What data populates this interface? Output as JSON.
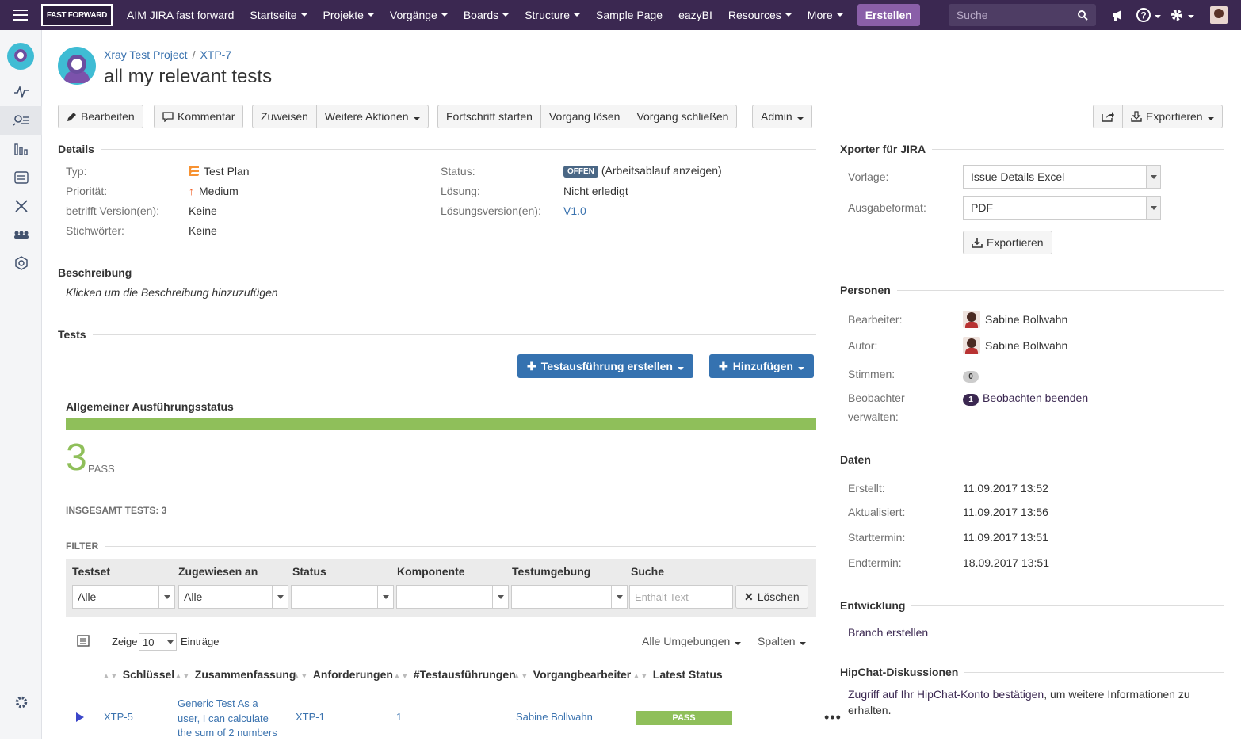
{
  "nav": {
    "logo_text": "FAST FORWARD",
    "title": "AIM JIRA fast forward",
    "items": [
      {
        "label": "Startseite",
        "caret": true
      },
      {
        "label": "Projekte",
        "caret": true
      },
      {
        "label": "Vorgänge",
        "caret": true
      },
      {
        "label": "Boards",
        "caret": true
      },
      {
        "label": "Structure",
        "caret": true
      },
      {
        "label": "Sample Page",
        "caret": false
      },
      {
        "label": "eazyBI",
        "caret": false
      },
      {
        "label": "Resources",
        "caret": true
      },
      {
        "label": "More",
        "caret": true
      }
    ],
    "create_label": "Erstellen",
    "search_placeholder": "Suche"
  },
  "breadcrumb": {
    "project": "Xray Test Project",
    "sep": "/",
    "key": "XTP-7"
  },
  "issue_title": "all my relevant tests",
  "toolbar": {
    "edit": "Bearbeiten",
    "comment": "Kommentar",
    "assign": "Zuweisen",
    "more_actions": "Weitere Aktionen",
    "start_progress": "Fortschritt starten",
    "resolve": "Vorgang lösen",
    "close": "Vorgang schließen",
    "admin": "Admin",
    "export": "Exportieren"
  },
  "details": {
    "heading": "Details",
    "type_label": "Typ:",
    "type_value": "Test Plan",
    "priority_label": "Priorität:",
    "priority_value": "Medium",
    "affects_label": "betrifft Version(en):",
    "affects_value": "Keine",
    "labels_label": "Stichwörter:",
    "labels_value": "Keine",
    "status_label": "Status:",
    "status_value": "OFFEN",
    "workflow_link": "(Arbeitsablauf anzeigen)",
    "resolution_label": "Lösung:",
    "resolution_value": "Nicht erledigt",
    "fixversion_label": "Lösungsversion(en):",
    "fixversion_value": "V1.0"
  },
  "description": {
    "heading": "Beschreibung",
    "placeholder": "Klicken um die Beschreibung hinzuzufügen"
  },
  "tests": {
    "heading": "Tests",
    "create_exec_button": "Testausführung erstellen",
    "add_button": "Hinzufügen",
    "overall_heading": "Allgemeiner Ausführungsstatus",
    "pass_count": "3",
    "pass_label": "PASS",
    "total_label": "INSGESAMT TESTS: 3",
    "pass_fraction": 1.0,
    "filter_heading": "FILTER",
    "filter": {
      "testset_label": "Testset",
      "testset_value": "Alle",
      "assignee_label": "Zugewiesen an",
      "assignee_value": "Alle",
      "status_label": "Status",
      "component_label": "Komponente",
      "environment_label": "Testumgebung",
      "search_label": "Suche",
      "search_placeholder": "Enthält Text",
      "clear_button": "Löschen"
    },
    "show_label": "Zeige",
    "page_size": "10",
    "entries_label": "Einträge",
    "all_envs": "Alle Umgebungen",
    "columns": "Spalten",
    "columns_list": [
      "Schlüssel",
      "Zusammenfassung",
      "Anforderungen",
      "#Testausführungen",
      "Vorgangbearbeiter",
      "Latest Status"
    ],
    "rows": [
      {
        "key": "XTP-5",
        "summary_lines": [
          "Generic Test As a",
          "user, I can calculate",
          "the sum of 2 numbers"
        ],
        "requirement": "XTP-1",
        "executions": "1",
        "assignee": "Sabine Bollwahn",
        "status": "PASS"
      }
    ]
  },
  "xporter": {
    "heading": "Xporter für JIRA",
    "template_label": "Vorlage:",
    "template_value": "Issue Details Excel",
    "format_label": "Ausgabeformat:",
    "format_value": "PDF",
    "export_button": "Exportieren"
  },
  "people": {
    "heading": "Personen",
    "assignee_label": "Bearbeiter:",
    "assignee_value": "Sabine Bollwahn",
    "reporter_label": "Autor:",
    "reporter_value": "Sabine Bollwahn",
    "votes_label": "Stimmen:",
    "votes_count": "0",
    "watchers_label_1": "Beobachter",
    "watchers_label_2": "verwalten:",
    "watchers_count": "1",
    "watch_link": "Beobachten beenden"
  },
  "dates": {
    "heading": "Daten",
    "created_label": "Erstellt:",
    "created_value": "11.09.2017 13:52",
    "updated_label": "Aktualisiert:",
    "updated_value": "11.09.2017 13:56",
    "start_label": "Starttermin:",
    "start_value": "11.09.2017 13:51",
    "end_label": "Endtermin:",
    "end_value": "18.09.2017 13:51"
  },
  "development": {
    "heading": "Entwicklung",
    "branch_link": "Branch erstellen"
  },
  "hipchat": {
    "heading": "HipChat-Diskussionen",
    "link": "Zugriff auf Ihr HipChat-Konto bestätigen",
    "text_1": ", um weitere Informationen zu",
    "text_2": "erhalten."
  },
  "colors": {
    "nav_bg": "#3b2851",
    "create_btn": "#8a5fa8",
    "blue_btn": "#3572b0",
    "pass_green": "#8fbf5a",
    "link": "#3b73af"
  }
}
